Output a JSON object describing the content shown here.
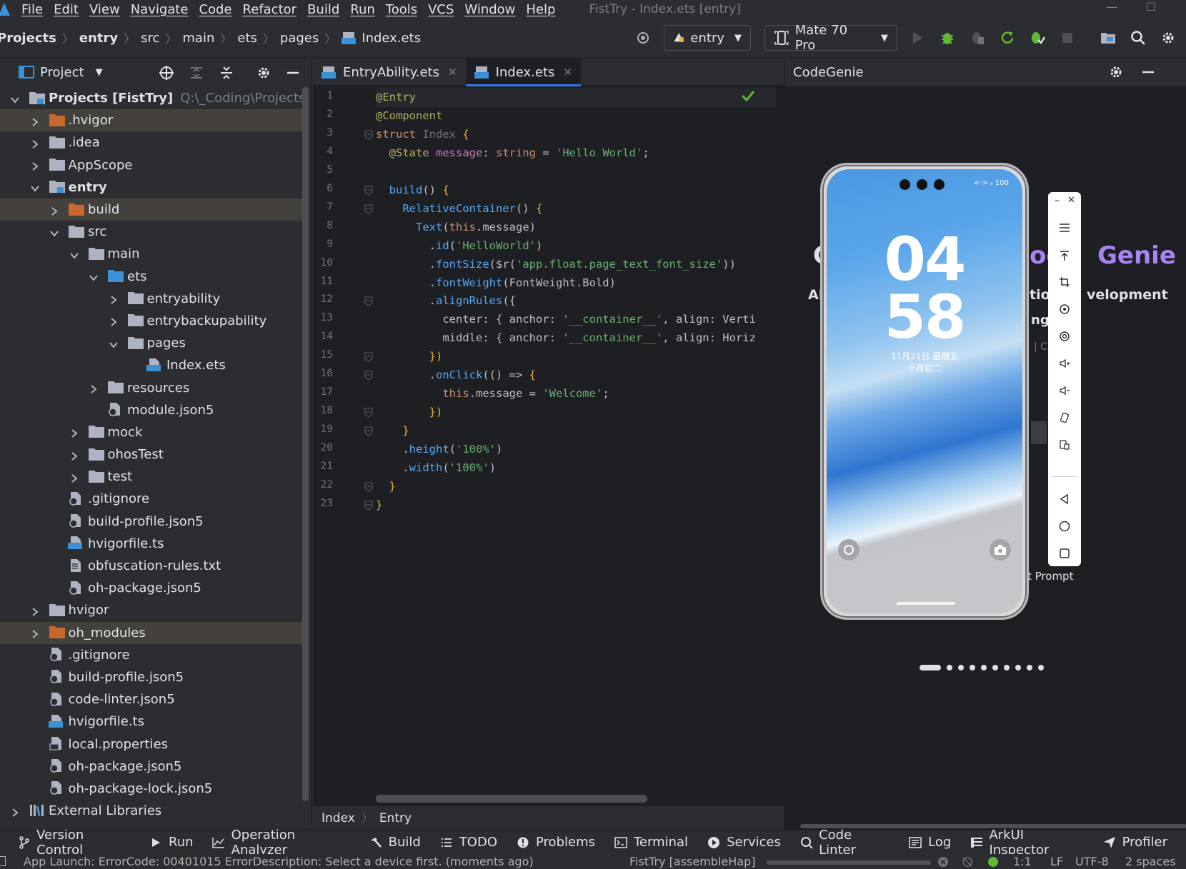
{
  "menubar": {
    "items": [
      "File",
      "Edit",
      "View",
      "Navigate",
      "Code",
      "Refactor",
      "Build",
      "Run",
      "Tools",
      "VCS",
      "Window",
      "Help"
    ],
    "window_title": "FistTry - Index.ets [entry]"
  },
  "navbar": {
    "breadcrumbs": [
      "Projects",
      "entry",
      "src",
      "main",
      "ets",
      "pages",
      "Index.ets"
    ],
    "module_select": "entry",
    "device_select": "Mate 70 Pro"
  },
  "project_panel": {
    "title": "Project",
    "tree": [
      {
        "label": "Projects [FistTry]",
        "extra": "Q:\\_Coding\\Projects",
        "depth": 0,
        "state": "open",
        "icon": "project-folder-icon",
        "bold": true
      },
      {
        "label": ".hvigor",
        "depth": 1,
        "state": "closed",
        "icon": "excluded-folder-icon",
        "hl": true
      },
      {
        "label": ".idea",
        "depth": 1,
        "state": "closed",
        "icon": "folder-icon"
      },
      {
        "label": "AppScope",
        "depth": 1,
        "state": "closed",
        "icon": "folder-icon"
      },
      {
        "label": "entry",
        "depth": 1,
        "state": "open",
        "icon": "module-folder-icon",
        "bold": true
      },
      {
        "label": "build",
        "depth": 2,
        "state": "closed",
        "icon": "excluded-folder-icon",
        "hl": true
      },
      {
        "label": "src",
        "depth": 2,
        "state": "open",
        "icon": "folder-icon"
      },
      {
        "label": "main",
        "depth": 3,
        "state": "open",
        "icon": "folder-icon"
      },
      {
        "label": "ets",
        "depth": 4,
        "state": "open",
        "icon": "source-folder-icon"
      },
      {
        "label": "entryability",
        "depth": 5,
        "state": "closed",
        "icon": "folder-icon"
      },
      {
        "label": "entrybackupability",
        "depth": 5,
        "state": "closed",
        "icon": "folder-icon"
      },
      {
        "label": "pages",
        "depth": 5,
        "state": "open",
        "icon": "folder-icon"
      },
      {
        "label": "Index.ets",
        "depth": 6,
        "state": "none",
        "icon": "ets-file-icon"
      },
      {
        "label": "resources",
        "depth": 4,
        "state": "closed",
        "icon": "folder-icon"
      },
      {
        "label": "module.json5",
        "depth": 4,
        "state": "none",
        "icon": "json5-file-icon"
      },
      {
        "label": "mock",
        "depth": 3,
        "state": "closed",
        "icon": "folder-icon"
      },
      {
        "label": "ohosTest",
        "depth": 3,
        "state": "closed",
        "icon": "folder-icon"
      },
      {
        "label": "test",
        "depth": 3,
        "state": "closed",
        "icon": "folder-icon"
      },
      {
        "label": ".gitignore",
        "depth": 2,
        "state": "none",
        "icon": "gitignore-file-icon"
      },
      {
        "label": "build-profile.json5",
        "depth": 2,
        "state": "none",
        "icon": "json5-file-icon"
      },
      {
        "label": "hvigorfile.ts",
        "depth": 2,
        "state": "none",
        "icon": "ts-file-icon"
      },
      {
        "label": "obfuscation-rules.txt",
        "depth": 2,
        "state": "none",
        "icon": "text-file-icon"
      },
      {
        "label": "oh-package.json5",
        "depth": 2,
        "state": "none",
        "icon": "json5-file-icon"
      },
      {
        "label": "hvigor",
        "depth": 1,
        "state": "closed",
        "icon": "folder-icon"
      },
      {
        "label": "oh_modules",
        "depth": 1,
        "state": "closed",
        "icon": "excluded-folder-icon",
        "hl": true
      },
      {
        "label": ".gitignore",
        "depth": 1,
        "state": "none",
        "icon": "gitignore-file-icon"
      },
      {
        "label": "build-profile.json5",
        "depth": 1,
        "state": "none",
        "icon": "json5-file-icon"
      },
      {
        "label": "code-linter.json5",
        "depth": 1,
        "state": "none",
        "icon": "json5-file-icon"
      },
      {
        "label": "hvigorfile.ts",
        "depth": 1,
        "state": "none",
        "icon": "ts-file-icon"
      },
      {
        "label": "local.properties",
        "depth": 1,
        "state": "none",
        "icon": "properties-file-icon"
      },
      {
        "label": "oh-package.json5",
        "depth": 1,
        "state": "none",
        "icon": "json5-file-icon"
      },
      {
        "label": "oh-package-lock.json5",
        "depth": 1,
        "state": "none",
        "icon": "json5-file-icon"
      },
      {
        "label": "External Libraries",
        "depth": 0,
        "state": "closed",
        "icon": "library-icon"
      }
    ]
  },
  "editor": {
    "tabs": [
      {
        "label": "EntryAbility.ets",
        "active": false
      },
      {
        "label": "Index.ets",
        "active": true
      }
    ],
    "lines": [
      [
        [
          "@Entry",
          "ann"
        ]
      ],
      [
        [
          "@Component",
          "ann"
        ]
      ],
      [
        [
          "struct ",
          "kw"
        ],
        [
          "Index ",
          "cls"
        ],
        [
          "{",
          "br"
        ]
      ],
      [
        [
          "  @State ",
          "ann"
        ],
        [
          "message",
          "prop"
        ],
        [
          ": ",
          "def"
        ],
        [
          "string",
          "kw"
        ],
        [
          " = ",
          "def"
        ],
        [
          "'Hello World'",
          "str"
        ],
        [
          ";",
          "def"
        ]
      ],
      [
        [
          "",
          "def"
        ]
      ],
      [
        [
          "  ",
          "def"
        ],
        [
          "build",
          "fn"
        ],
        [
          "() ",
          "def"
        ],
        [
          "{",
          "br"
        ]
      ],
      [
        [
          "    ",
          "def"
        ],
        [
          "RelativeContainer",
          "fn"
        ],
        [
          "() ",
          "def"
        ],
        [
          "{",
          "br"
        ]
      ],
      [
        [
          "      ",
          "def"
        ],
        [
          "Text",
          "fn"
        ],
        [
          "(",
          "def"
        ],
        [
          "this",
          "kw"
        ],
        [
          ".message)",
          "def"
        ]
      ],
      [
        [
          "        .",
          "def"
        ],
        [
          "id",
          "fn"
        ],
        [
          "(",
          "def"
        ],
        [
          "'HelloWorld'",
          "str"
        ],
        [
          ")",
          "def"
        ]
      ],
      [
        [
          "        .",
          "def"
        ],
        [
          "fontSize",
          "fn"
        ],
        [
          "($r(",
          "def"
        ],
        [
          "'app.float.page_text_font_size'",
          "str"
        ],
        [
          "))",
          "def"
        ]
      ],
      [
        [
          "        .",
          "def"
        ],
        [
          "fontWeight",
          "fn"
        ],
        [
          "(FontWeight.Bold)",
          "def"
        ]
      ],
      [
        [
          "        .",
          "def"
        ],
        [
          "alignRules",
          "fn"
        ],
        [
          "({",
          "def"
        ]
      ],
      [
        [
          "          center: { anchor: ",
          "def"
        ],
        [
          "'__container__'",
          "str"
        ],
        [
          ", align: Verti",
          "def"
        ]
      ],
      [
        [
          "          middle: { anchor: ",
          "def"
        ],
        [
          "'__container__'",
          "str"
        ],
        [
          ", align: Horiz",
          "def"
        ]
      ],
      [
        [
          "        })",
          "br"
        ]
      ],
      [
        [
          "        .",
          "def"
        ],
        [
          "onClick",
          "fn"
        ],
        [
          "(() => ",
          "def"
        ],
        [
          "{",
          "br"
        ]
      ],
      [
        [
          "          ",
          "def"
        ],
        [
          "this",
          "kw"
        ],
        [
          ".message = ",
          "def"
        ],
        [
          "'Welcome'",
          "str"
        ],
        [
          ";",
          "def"
        ]
      ],
      [
        [
          "        })",
          "br"
        ]
      ],
      [
        [
          "    }",
          "br"
        ]
      ],
      [
        [
          "    .",
          "def"
        ],
        [
          "height",
          "fn"
        ],
        [
          "(",
          "def"
        ],
        [
          "'100%'",
          "str"
        ],
        [
          ")",
          "def"
        ]
      ],
      [
        [
          "    .",
          "def"
        ],
        [
          "width",
          "fn"
        ],
        [
          "(",
          "def"
        ],
        [
          "'100%'",
          "str"
        ],
        [
          ")",
          "def"
        ]
      ],
      [
        [
          "  }",
          "br"
        ]
      ],
      [
        [
          "}",
          "br"
        ]
      ]
    ],
    "breadcrumb": [
      "Index",
      "Entry"
    ]
  },
  "genie": {
    "title": "CodeGenie",
    "fragments": [
      "C",
      "oc",
      "Genie",
      "AI",
      "tio",
      "velopment",
      "ngi",
      "| C",
      "t Prompt"
    ]
  },
  "phone": {
    "hour": "04",
    "minute": "58",
    "date": "11月21日 星期五",
    "lunar": "十月初二",
    "status": "<·> ᵢₗ 100"
  },
  "bottom_tools": [
    "Version Control",
    "Run",
    "Operation Analyzer",
    "Build",
    "TODO",
    "Problems",
    "Terminal",
    "Services",
    "Code Linter",
    "Log",
    "ArkUI Inspector",
    "Profiler"
  ],
  "statusbar": {
    "message": "App Launch: ErrorCode: 00401015 ErrorDescription: Select a device first. (moments ago)",
    "task": "FistTry [assembleHap]",
    "position": "1:1",
    "line_sep": "LF",
    "encoding": "UTF-8",
    "indent": "2 spaces"
  },
  "colors": {
    "accent": "#3574f0",
    "excluded_folder": "#c7692f",
    "folder": "#aeb3c2",
    "source_folder": "#3d8fd6",
    "run_green": "#5fb832",
    "check_green": "#5fb832",
    "genie_purple": "#a884f3"
  }
}
